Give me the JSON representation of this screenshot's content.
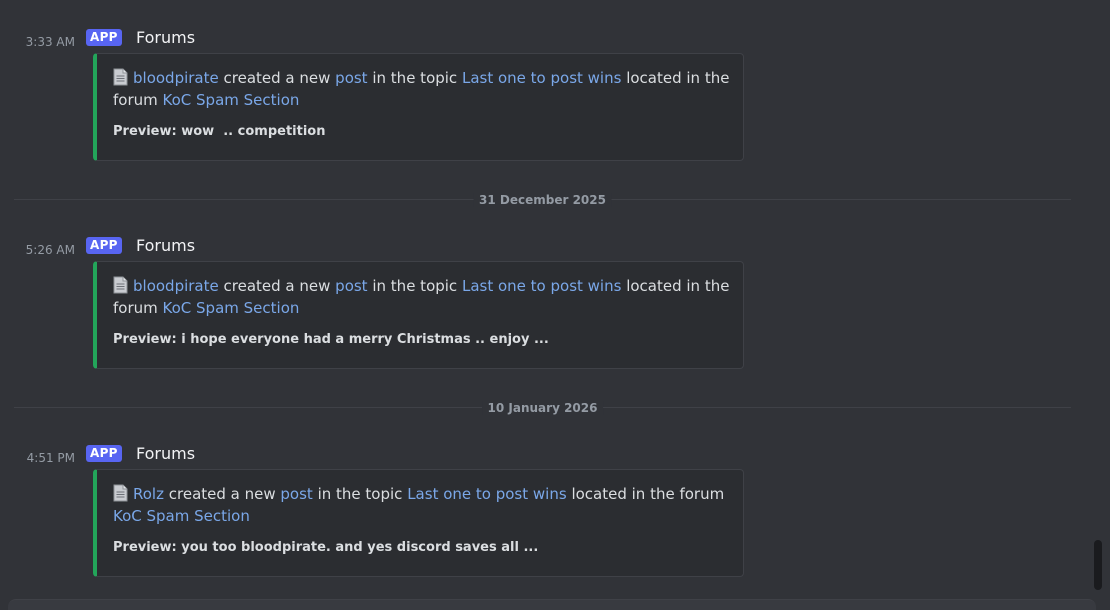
{
  "messages": [
    {
      "timestamp": "3:33 AM",
      "badge": "APP",
      "author": "Forums",
      "icon": "document-icon",
      "user": "bloodpirate",
      "t1": "created a new",
      "post_link": "post",
      "t2": "in the topic",
      "topic": "Last one to post wins",
      "t3": "located in the forum",
      "forum": "KoC Spam Section",
      "preview": "Preview: wow  .. competition"
    },
    {
      "timestamp": "5:26 AM",
      "badge": "APP",
      "author": "Forums",
      "icon": "document-icon",
      "user": "bloodpirate",
      "t1": "created a new",
      "post_link": "post",
      "t2": "in the topic",
      "topic": "Last one to post wins",
      "t3": "located in the forum",
      "forum": "KoC Spam Section",
      "preview": "Preview: i hope everyone had a merry Christmas .. enjoy ..."
    },
    {
      "timestamp": "4:51 PM",
      "badge": "APP",
      "author": "Forums",
      "icon": "document-icon",
      "user": "Rolz",
      "t1": "created a new",
      "post_link": "post",
      "t2": "in the topic",
      "topic": "Last one to post wins",
      "t3": "located in the forum",
      "forum": "KoC Spam Section",
      "preview": "Preview: you too bloodpirate. and yes discord saves all ..."
    }
  ],
  "dividers": [
    "31 December 2025",
    "10 January 2026"
  ],
  "colors": {
    "background": "#313338",
    "embed_bg": "#2b2d31",
    "embed_accent": "#23a55a",
    "badge": "#5865f2",
    "link": "#7aa7e8"
  }
}
